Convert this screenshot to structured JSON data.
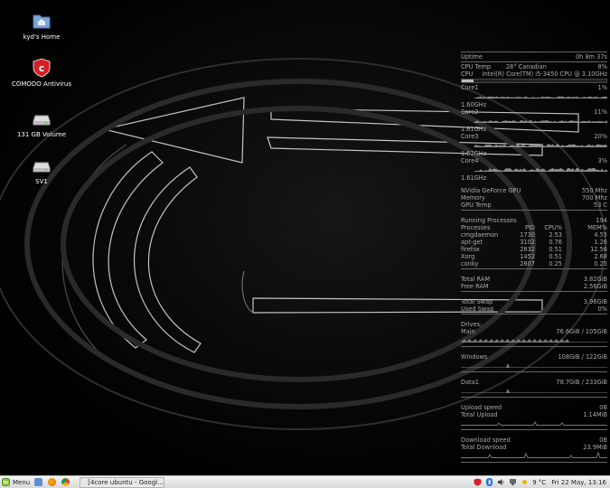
{
  "desktop": {
    "icons": [
      {
        "label": "kyd's Home",
        "icon": "home-folder-icon"
      },
      {
        "label": "COMODO Antivirus",
        "icon": "comodo-shield-icon"
      },
      {
        "label": "131 GB Volume",
        "icon": "drive-icon"
      },
      {
        "label": "SV1",
        "icon": "drive-icon"
      }
    ]
  },
  "conky": {
    "uptime": {
      "label": "Uptime",
      "value": "0h 8m 37s"
    },
    "cpu_temp": {
      "label": "CPU Temp",
      "value": "28° Canadian",
      "pct": "8%"
    },
    "cpu": {
      "label": "CPU",
      "value": "Intel(R) Core(TM) i5-3450 CPU @ 3.10GHz",
      "usage": 0.08
    },
    "cores": [
      {
        "label": "Core1",
        "pct": "1%",
        "freq": "1.60GHz"
      },
      {
        "label": "Core2",
        "pct": "11%",
        "freq": "1.61GHz"
      },
      {
        "label": "Core3",
        "pct": "20%",
        "freq": "1.62GHz"
      },
      {
        "label": "Core4",
        "pct": "3%",
        "freq": "1.61GHz"
      }
    ],
    "gpu": {
      "label": "NVidia GeForce GPU",
      "value": "550 Mhz"
    },
    "memory_clock": {
      "label": "Memory",
      "value": "700 Mhz"
    },
    "gpu_temp": {
      "label": "GPU Temp",
      "value": "53 C"
    },
    "running_processes": {
      "label": "Running Processes",
      "value": "194"
    },
    "proc_header": {
      "name": "Processes",
      "pid": "PID",
      "cpu": "CPU%",
      "mem": "MEM%"
    },
    "processes": [
      {
        "name": "cmgdaemon",
        "pid": "1730",
        "cpu": "2.53",
        "mem": "4.55"
      },
      {
        "name": "apt-get",
        "pid": "3102",
        "cpu": "0.76",
        "mem": "1.26"
      },
      {
        "name": "firefox",
        "pid": "2832",
        "cpu": "0.51",
        "mem": "12.56"
      },
      {
        "name": "Xorg",
        "pid": "1452",
        "cpu": "0.51",
        "mem": "2.68"
      },
      {
        "name": "conky",
        "pid": "2807",
        "cpu": "0.25",
        "mem": "0.25"
      }
    ],
    "total_ram": {
      "label": "Total RAM",
      "value": "3.82GiB"
    },
    "free_ram": {
      "label": "Free RAM",
      "value": "2.56GiB"
    },
    "total_swap": {
      "label": "Total Swap",
      "value": "3.96GiB"
    },
    "used_swap": {
      "label": "Used Swap",
      "value": "0%"
    },
    "drives_label": "Drives:",
    "drives": [
      {
        "label": "Main",
        "value": "76.6GiB / 105GiB",
        "usage": 0.73
      },
      {
        "label": "Windows",
        "value": "108GiB / 122GiB",
        "usage": 0.89
      },
      {
        "label": "Data1",
        "value": "78.7GiB / 233GiB",
        "usage": 0.34
      }
    ],
    "upload_speed": {
      "label": "Upload speed",
      "value": "0B"
    },
    "total_upload": {
      "label": "Total Upload",
      "value": "1.14MiB"
    },
    "download_speed": {
      "label": "Download speed",
      "value": "0B"
    },
    "total_download": {
      "label": "Total Download",
      "value": "23.9MiB"
    }
  },
  "taskbar": {
    "menu_label": "Menu",
    "launchers": [
      "file-manager-icon",
      "firefox-icon",
      "chrome-icon"
    ],
    "task": {
      "label": "[4core ubuntu - Googl...",
      "icon": "chrome-icon"
    },
    "tray": {
      "icons": [
        "comodo-tray-icon",
        "bluetooth-icon",
        "volume-icon",
        "network-icon",
        "weather-icon"
      ],
      "temperature": "9 °C",
      "clock": "Fri 22 May, 13:16"
    }
  },
  "colors": {
    "taskbar_bg": "#e6e6e6",
    "conky_text": "#aaaaaa",
    "desktop_bg": "#000000",
    "comodo_red": "#d32027"
  }
}
